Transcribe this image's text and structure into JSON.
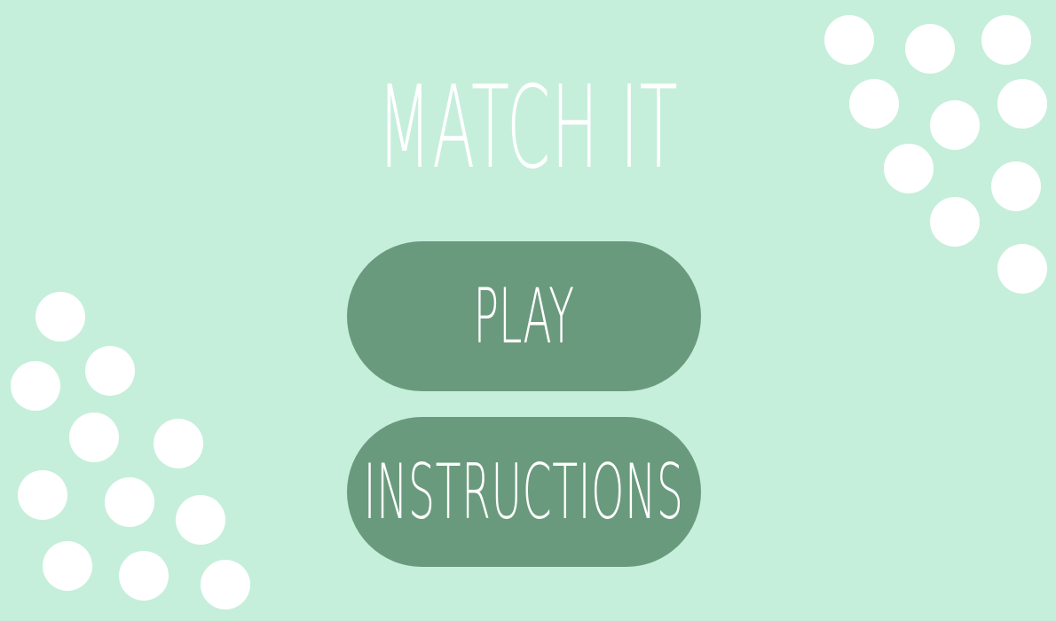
{
  "title": "MATCH IT",
  "buttons": {
    "play_label": "PLAY",
    "instructions_label": "INSTRUCTIONS"
  },
  "colors": {
    "background": "#c5efdb",
    "button": "#6a9a7d",
    "text": "#ffffff",
    "dots": "#ffffff"
  }
}
